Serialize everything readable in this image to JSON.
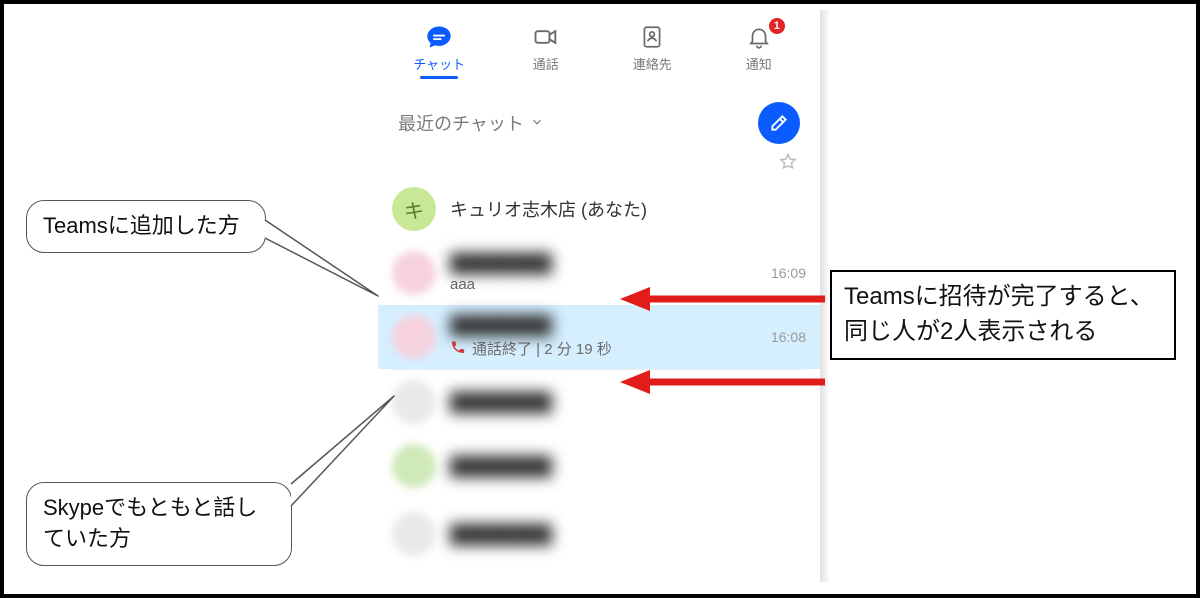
{
  "tabs": {
    "chat": {
      "label": "チャット"
    },
    "calls": {
      "label": "通話"
    },
    "contacts": {
      "label": "連絡先"
    },
    "activity": {
      "label": "通知",
      "badge": "1"
    }
  },
  "section": {
    "title": "最近のチャット",
    "compose_label": "新しいチャット"
  },
  "chats": {
    "self": {
      "name": "キュリオ志木店 (あなた)",
      "initials": "キ"
    },
    "item1": {
      "name": "████████",
      "snippet": "aaa",
      "time": "16:09"
    },
    "item2": {
      "name": "████████",
      "snippet": "通話終了 | 2 分 19 秒",
      "time": "16:08",
      "call_icon": "📞"
    }
  },
  "callouts": {
    "top": "Teamsに追加した方",
    "bottom": "Skypeでもともと話していた方",
    "right": "Teamsに招待が完了すると、同じ人が2人表示される"
  }
}
